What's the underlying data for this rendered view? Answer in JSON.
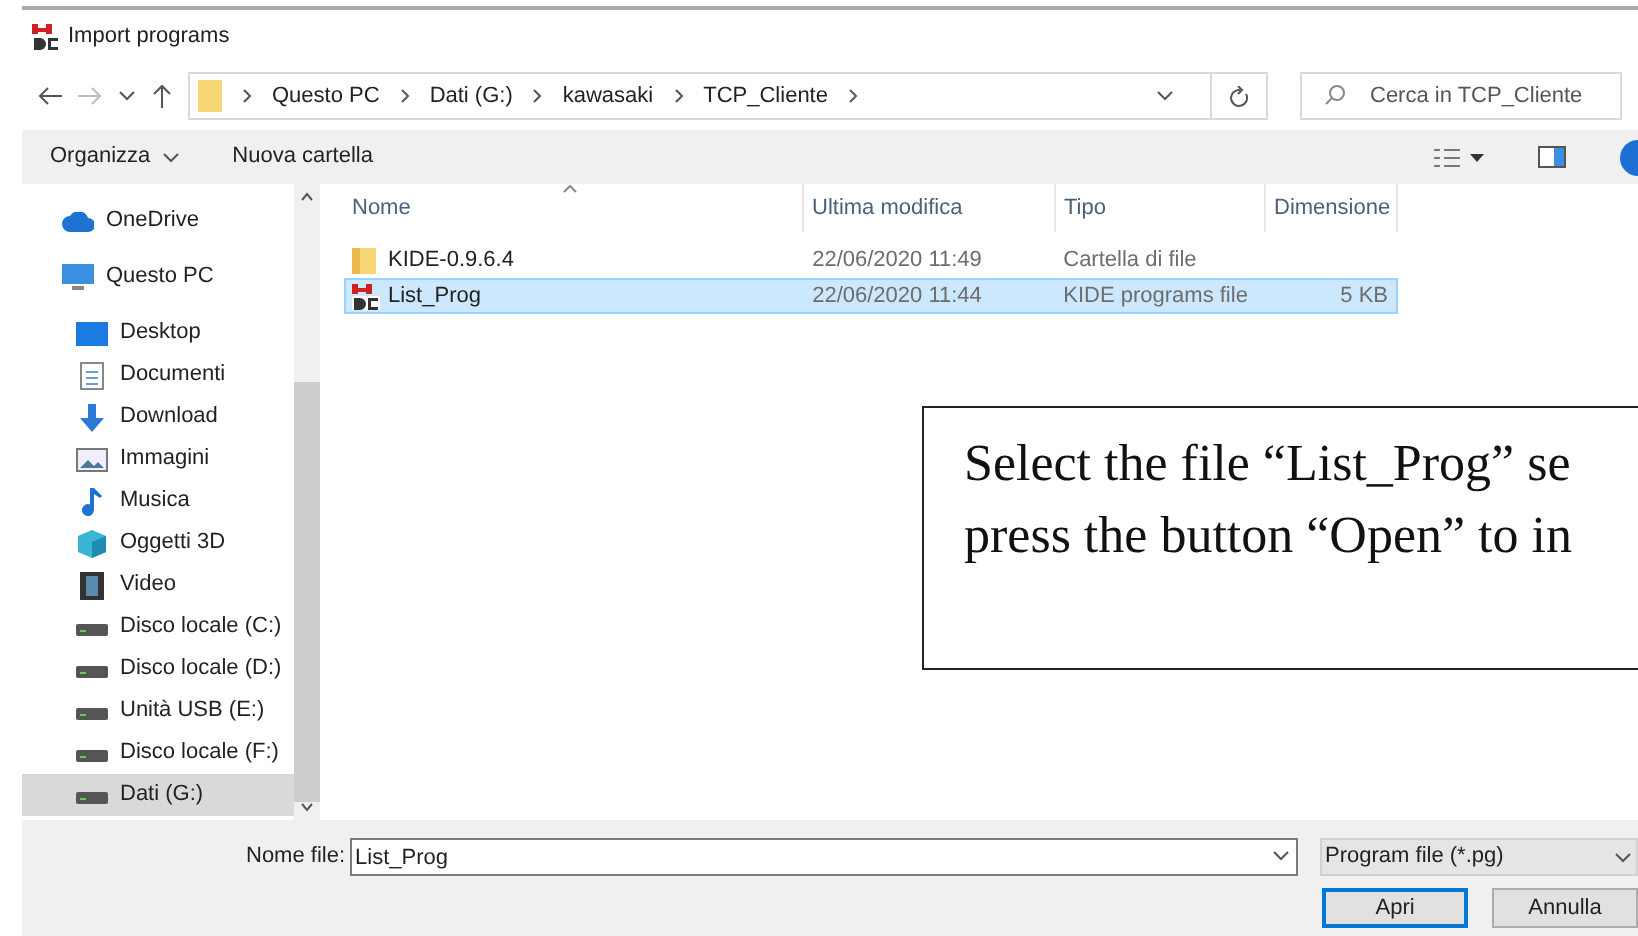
{
  "window": {
    "title": "Import programs"
  },
  "address": {
    "crumbs": [
      "Questo PC",
      "Dati (G:)",
      "kawasaki",
      "TCP_Cliente"
    ]
  },
  "search": {
    "placeholder": "Cerca in TCP_Cliente"
  },
  "toolbar": {
    "items": [
      "Organizza",
      "Nuova cartella"
    ]
  },
  "sidebar": {
    "items": [
      {
        "label": "OneDrive",
        "kind": "cloud",
        "selected": false
      },
      {
        "label": "Questo PC",
        "kind": "pc",
        "selected": false
      },
      {
        "label": "Desktop",
        "kind": "desktop",
        "selected": false
      },
      {
        "label": "Documenti",
        "kind": "doc",
        "selected": false
      },
      {
        "label": "Download",
        "kind": "download",
        "selected": false
      },
      {
        "label": "Immagini",
        "kind": "image",
        "selected": false
      },
      {
        "label": "Musica",
        "kind": "music",
        "selected": false
      },
      {
        "label": "Oggetti 3D",
        "kind": "cube",
        "selected": false
      },
      {
        "label": "Video",
        "kind": "video",
        "selected": false
      },
      {
        "label": "Disco locale (C:)",
        "kind": "drive",
        "selected": false
      },
      {
        "label": "Disco locale (D:)",
        "kind": "drive",
        "selected": false
      },
      {
        "label": "Unità USB (E:)",
        "kind": "drive",
        "selected": false
      },
      {
        "label": "Disco locale (F:)",
        "kind": "drive",
        "selected": false
      },
      {
        "label": "Dati (G:)",
        "kind": "drive",
        "selected": true
      }
    ]
  },
  "table": {
    "columns": [
      "Nome",
      "Ultima modifica",
      "Tipo",
      "Dimensione"
    ],
    "rows": [
      {
        "kind": "folder",
        "name": "KIDE-0.9.6.4",
        "modified": "22/06/2020 11:49",
        "type": "Cartella di file",
        "selected": false
      },
      {
        "kind": "program",
        "name": "List_Prog",
        "modified": "22/06/2020 11:44",
        "type": "KIDE programs file",
        "size": "5 KB",
        "selected": true
      }
    ]
  },
  "footer": {
    "filename_label": "Nome file:",
    "filename": "List_Prog",
    "filter": "Program file (*.pg)",
    "buttons": [
      "Apri",
      "Annulla"
    ]
  },
  "callout": {
    "lines": [
      "Select the file “List_Prog” se",
      "press the button “Open” to in"
    ]
  }
}
